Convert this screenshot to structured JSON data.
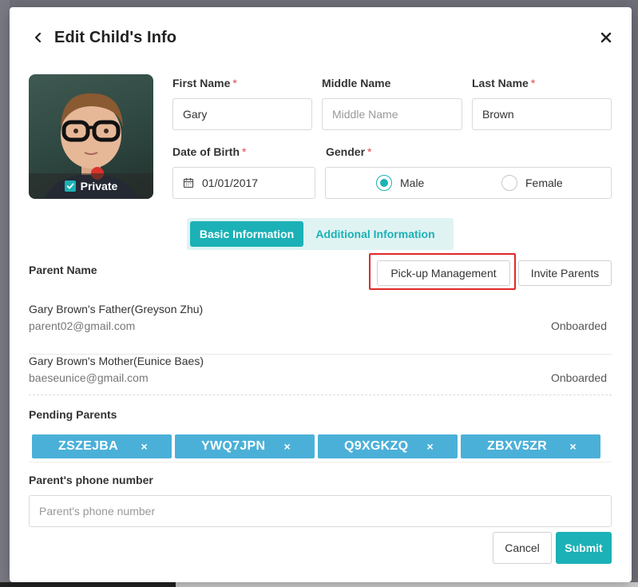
{
  "modal": {
    "title": "Edit Child's Info",
    "back_icon": "chevron-left-icon",
    "close_icon": "close-icon"
  },
  "photo": {
    "private_label": "Private",
    "private_checked": true
  },
  "form": {
    "first_name": {
      "label": "First Name",
      "value": "Gary",
      "placeholder": "First Name",
      "required": true
    },
    "middle_name": {
      "label": "Middle Name",
      "value": "",
      "placeholder": "Middle Name",
      "required": false
    },
    "last_name": {
      "label": "Last Name",
      "value": "Brown",
      "placeholder": "Last Name",
      "required": true
    },
    "dob": {
      "label": "Date of Birth",
      "value": "01/01/2017",
      "required": true,
      "icon": "calendar-icon"
    },
    "gender": {
      "label": "Gender",
      "required": true,
      "selected": "Male",
      "options": [
        "Male",
        "Female"
      ]
    }
  },
  "tabs": [
    {
      "label": "Basic Information",
      "active": true
    },
    {
      "label": "Additional Information",
      "active": false
    }
  ],
  "parents_section": {
    "title": "Parent Name",
    "pickup_button": "Pick-up Management",
    "invite_button": "Invite Parents",
    "parents": [
      {
        "name": "Gary Brown's Father(Greyson Zhu)",
        "email": "parent02@gmail.com",
        "status": "Onboarded"
      },
      {
        "name": "Gary Brown's Mother(Eunice Baes)",
        "email": "baeseunice@gmail.com",
        "status": "Onboarded"
      }
    ]
  },
  "pending_section": {
    "title": "Pending Parents",
    "codes": [
      "ZSZEJBA",
      "YWQ7JPN",
      "Q9XGKZQ",
      "ZBXV5ZR"
    ],
    "remove_symbol": "×"
  },
  "phone_section": {
    "title": "Parent's phone number",
    "placeholder": "Parent's phone number",
    "value": ""
  },
  "actions": {
    "cancel": "Cancel",
    "submit": "Submit"
  },
  "colors": {
    "accent": "#1bb1b6",
    "chip": "#4bb0d8",
    "required": "#e04848",
    "highlight": "#e02828"
  }
}
